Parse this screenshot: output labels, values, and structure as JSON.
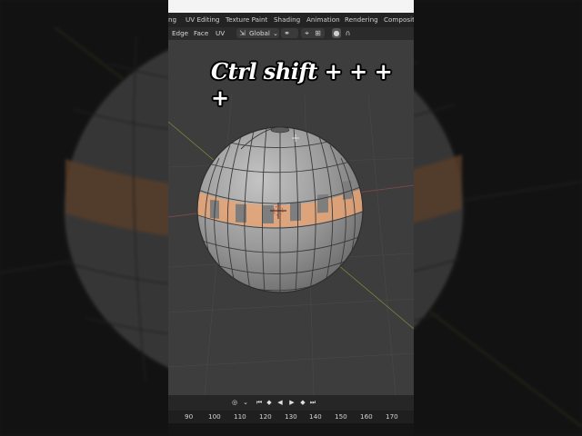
{
  "workspace_tabs": [
    "ng",
    "UV Editing",
    "Texture Paint",
    "Shading",
    "Animation",
    "Rendering",
    "Compositing"
  ],
  "header": {
    "select_modes": [
      "Edge",
      "Face",
      "UV"
    ],
    "transform_orientation": "Global"
  },
  "overlay_caption": "Ctrl shift + + + +",
  "timeline": {
    "frame_ticks": [
      "90",
      "100",
      "110",
      "120",
      "130",
      "140",
      "150",
      "160",
      "170"
    ]
  },
  "colors": {
    "viewport_bg": "#3d3d3d",
    "mesh_face": "#9a9a9a",
    "selection": "#e7a575",
    "header_bg": "#2b2b2b",
    "workspace_bg": "#232323"
  },
  "icons": [
    "transform-orientation-icon",
    "pivot-point-icon",
    "snapping-icon",
    "proportional-editing-icon",
    "falloff-icon",
    "playback-controls"
  ]
}
